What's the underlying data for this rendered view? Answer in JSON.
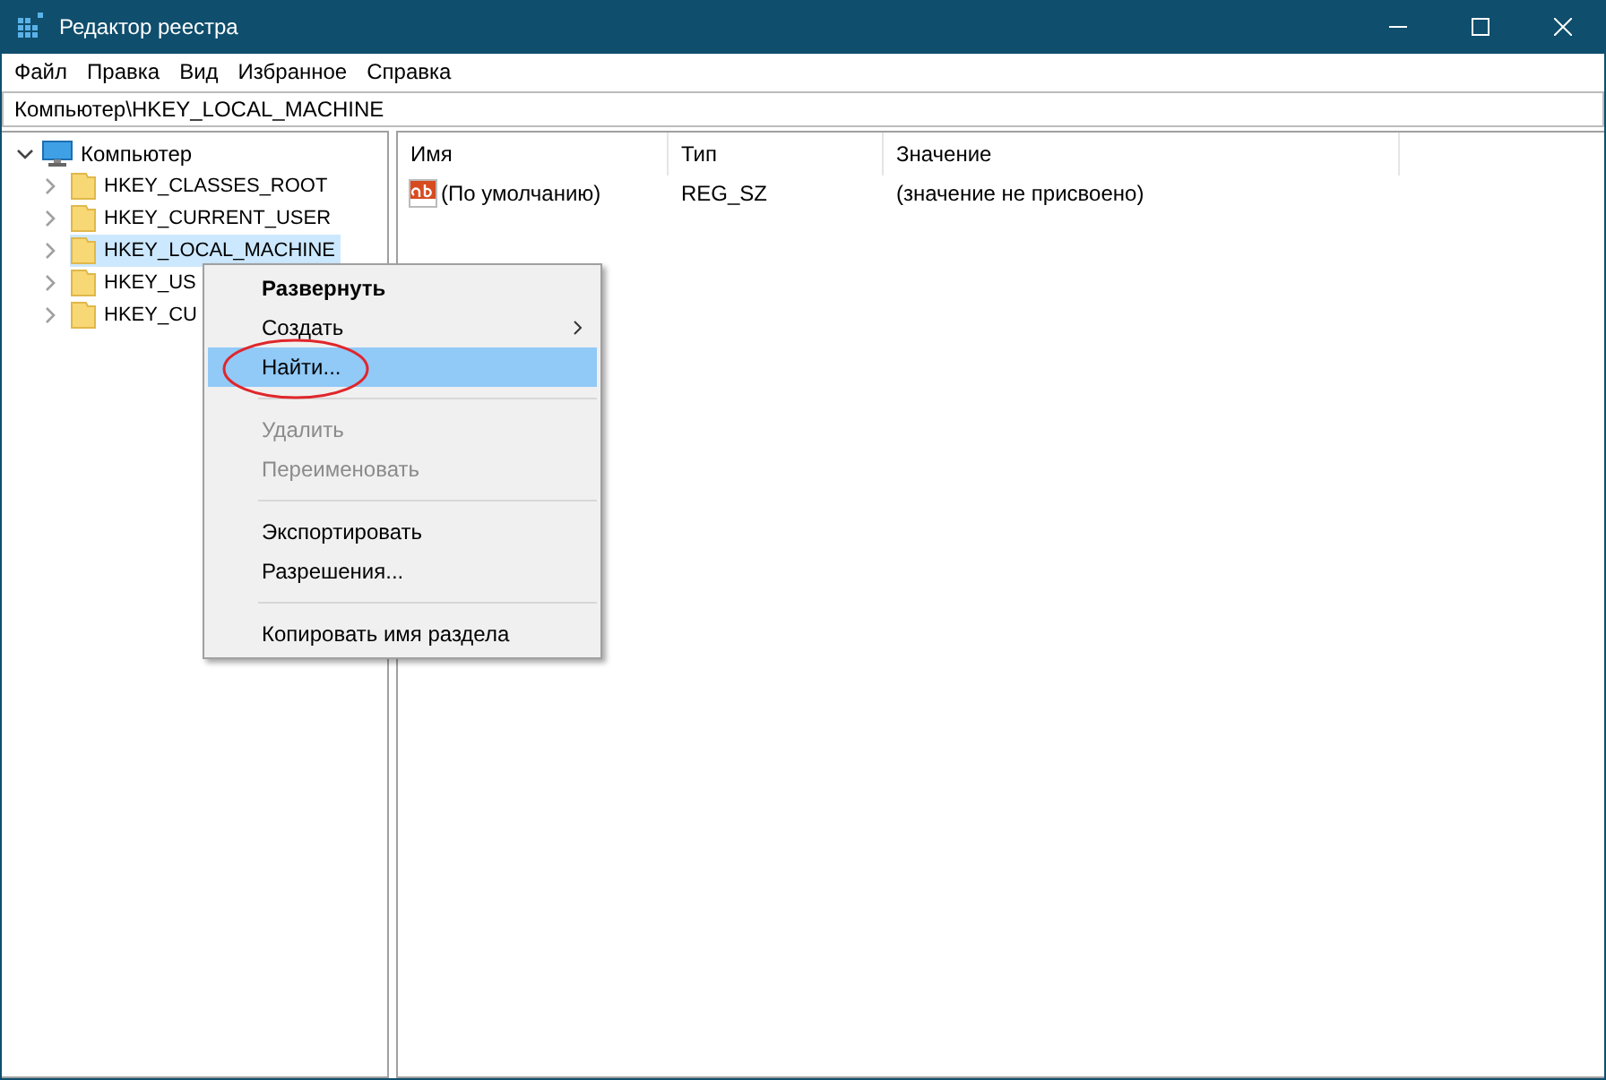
{
  "window": {
    "title": "Редактор реестра"
  },
  "menu_bar": [
    "Файл",
    "Правка",
    "Вид",
    "Избранное",
    "Справка"
  ],
  "address": "Компьютер\\HKEY_LOCAL_MACHINE",
  "tree": {
    "label": "Компьютер",
    "expanded": true,
    "children": [
      {
        "label": "HKEY_CLASSES_ROOT",
        "selected": false
      },
      {
        "label": "HKEY_CURRENT_USER",
        "selected": false
      },
      {
        "label": "HKEY_LOCAL_MACHINE",
        "selected": true
      },
      {
        "label": "HKEY_US",
        "selected": false
      },
      {
        "label": "HKEY_CU",
        "selected": false
      }
    ]
  },
  "values": {
    "columns": [
      "Имя",
      "Тип",
      "Значение"
    ],
    "rows": [
      {
        "name": "(По умолчанию)",
        "type": "REG_SZ",
        "data": "(значение не присвоено)"
      }
    ]
  },
  "context_menu": [
    {
      "kind": "item",
      "label": "Развернуть",
      "default": true,
      "disabled": false,
      "selected": false,
      "submenu": false
    },
    {
      "kind": "item",
      "label": "Создать",
      "default": false,
      "disabled": false,
      "selected": false,
      "submenu": true
    },
    {
      "kind": "item",
      "label": "Найти...",
      "default": false,
      "disabled": false,
      "selected": true,
      "submenu": false
    },
    {
      "kind": "separator"
    },
    {
      "kind": "item",
      "label": "Удалить",
      "default": false,
      "disabled": true,
      "selected": false,
      "submenu": false
    },
    {
      "kind": "item",
      "label": "Переименовать",
      "default": false,
      "disabled": true,
      "selected": false,
      "submenu": false
    },
    {
      "kind": "separator"
    },
    {
      "kind": "item",
      "label": "Экспортировать",
      "default": false,
      "disabled": false,
      "selected": false,
      "submenu": false
    },
    {
      "kind": "item",
      "label": "Разрешения...",
      "default": false,
      "disabled": false,
      "selected": false,
      "submenu": false
    },
    {
      "kind": "separator"
    },
    {
      "kind": "item",
      "label": "Копировать имя раздела",
      "default": false,
      "disabled": false,
      "selected": false,
      "submenu": false
    }
  ]
}
